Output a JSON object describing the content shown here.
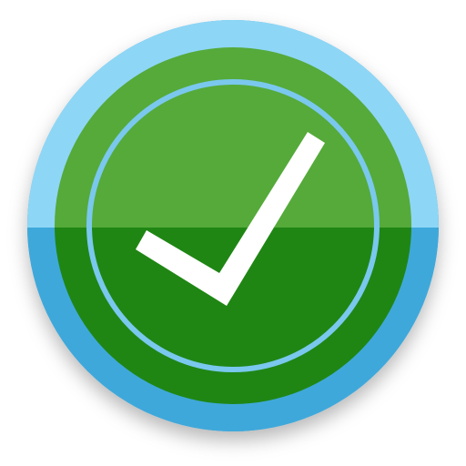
{
  "icon": {
    "name": "checkmark-badge-icon",
    "colors": {
      "outer_ring_top": "#8ed6f6",
      "outer_ring_bottom": "#3fa8da",
      "green_top": "#55aa3a",
      "green_bottom": "#1f8614",
      "inner_ring": "#7ac8ee",
      "check": "#ffffff"
    }
  }
}
